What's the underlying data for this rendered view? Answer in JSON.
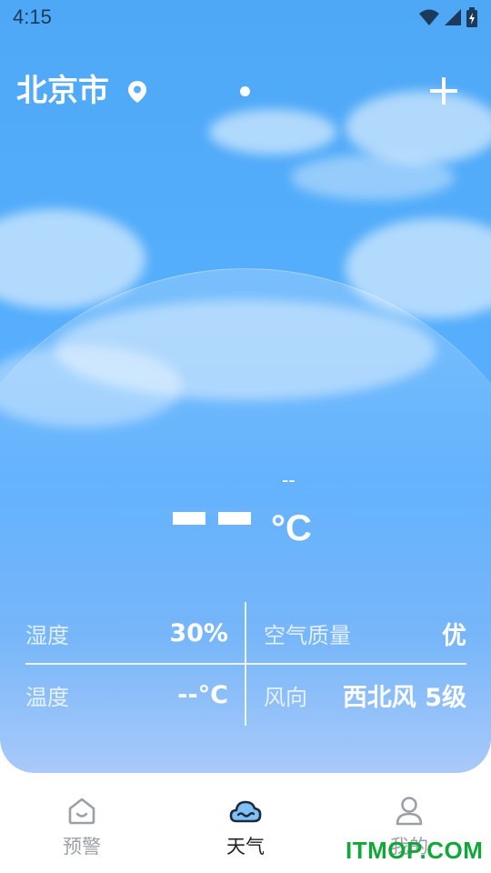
{
  "status_bar": {
    "time": "4:15"
  },
  "header": {
    "city": "北京市"
  },
  "weather": {
    "high": "--",
    "unit": "°C"
  },
  "details": [
    {
      "label": "湿度",
      "value": "30%"
    },
    {
      "label": "空气质量",
      "value": "优"
    },
    {
      "label": "温度",
      "value": "--°C"
    },
    {
      "label": "风向",
      "value": "西北风 5级"
    }
  ],
  "nav": {
    "items": [
      {
        "label": "预警",
        "icon": "warning-icon",
        "active": false
      },
      {
        "label": "天气",
        "icon": "cloud-icon",
        "active": true
      },
      {
        "label": "我的",
        "icon": "user-icon",
        "active": false
      }
    ]
  },
  "colors": {
    "sky_top": "#4ea8f6",
    "sky_bottom": "#a9c9f9",
    "active_nav": "#222222"
  },
  "watermark": "ITMOP.COM"
}
